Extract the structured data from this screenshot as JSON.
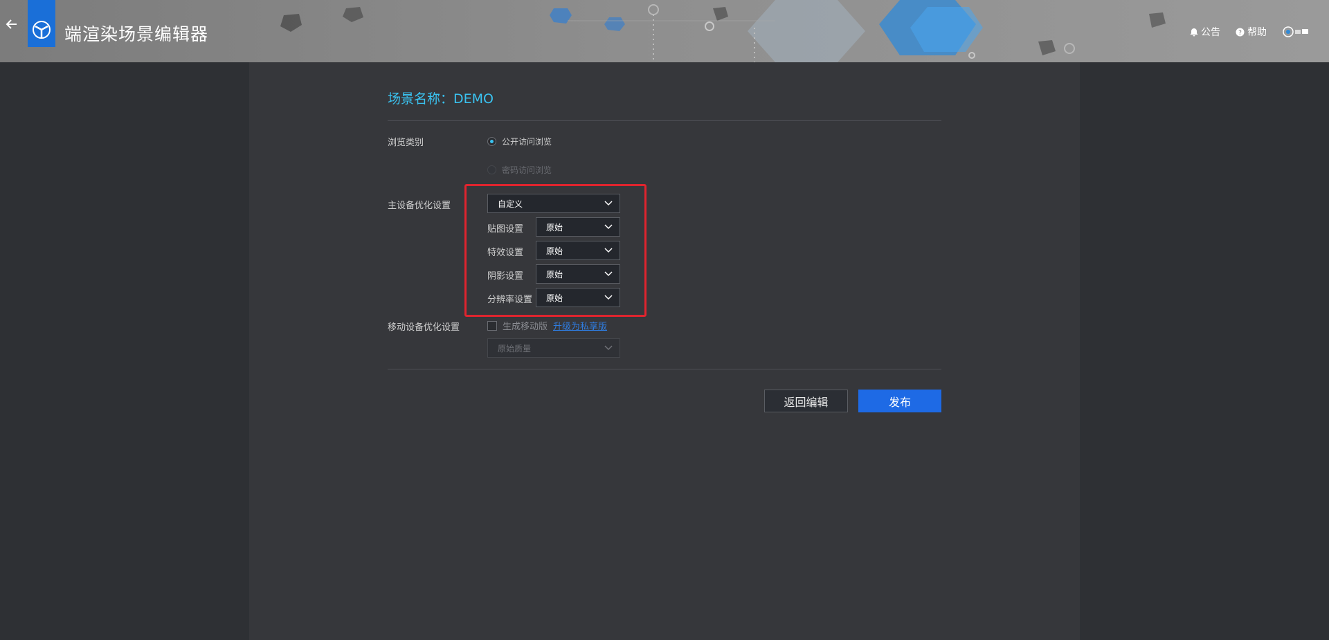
{
  "header": {
    "title": "端渲染场景编辑器",
    "notice_label": "公告",
    "help_label": "帮助",
    "icons": [
      "back-arrow-icon",
      "logo-icon",
      "bell-icon",
      "help-icon",
      "user-icon"
    ]
  },
  "scene": {
    "title": "场景名称：DEMO"
  },
  "browse": {
    "label": "浏览类别",
    "options": [
      {
        "label": "公开访问浏览",
        "selected": true,
        "disabled": false
      },
      {
        "label": "密码访问浏览",
        "selected": false,
        "disabled": true
      }
    ]
  },
  "main_device": {
    "label": "主设备优化设置",
    "preset_value": "自定义",
    "settings": [
      {
        "label": "贴图设置",
        "value": "原始"
      },
      {
        "label": "特效设置",
        "value": "原始"
      },
      {
        "label": "阴影设置",
        "value": "原始"
      },
      {
        "label": "分辨率设置",
        "value": "原始"
      }
    ]
  },
  "mobile_device": {
    "label": "移动设备优化设置",
    "checkbox_label": "生成移动版",
    "checked": false,
    "upgrade_link": "升级为私享版",
    "quality_value": "原始质量"
  },
  "actions": {
    "back_label": "返回编辑",
    "publish_label": "发布"
  },
  "colors": {
    "accent": "#3ac3f1",
    "primary_button": "#1e6ae5",
    "highlight_box": "#e0242e",
    "link": "#2f7de1"
  }
}
